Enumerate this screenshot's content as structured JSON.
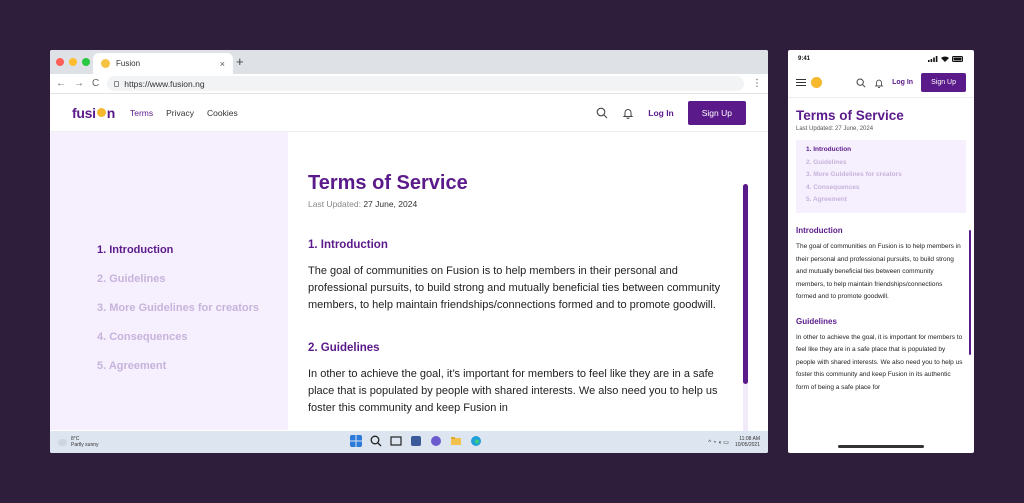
{
  "browser": {
    "tab_title": "Fusion",
    "tab_close": "×",
    "new_tab": "+",
    "back": "←",
    "forward": "→",
    "reload": "C",
    "url": "https://www.fusion.ng",
    "menu": "⋮"
  },
  "site": {
    "logo_pre": "fusi",
    "logo_post": "n",
    "nav": [
      "Terms",
      "Privacy",
      "Cookies"
    ],
    "login": "Log In",
    "signup": "Sign Up"
  },
  "toc": [
    "1. Introduction",
    "2. Guidelines",
    "3. More Guidelines for creators",
    "4. Consequences",
    "5. Agreement"
  ],
  "doc": {
    "title": "Terms of Service",
    "updated_label": "Last Updated:",
    "updated_date": "27 June, 2024",
    "sections": [
      {
        "heading": "1. Introduction",
        "body": "The goal of communities on Fusion is to help members in their personal and professional pursuits, to build strong and mutually beneficial ties between community members, to help maintain friendships/connections formed and to promote goodwill."
      },
      {
        "heading": "2. Guidelines",
        "body": "In other to achieve the goal, it’s important for members to feel like they are in a safe place that is populated by people with shared interests. We also need you to help us foster this community and keep Fusion in"
      }
    ]
  },
  "taskbar": {
    "temp": "8°C",
    "weather": "Partly sunny",
    "time": "11:08 AM",
    "date": "10/05/2021"
  },
  "mobile": {
    "time": "9:41",
    "login": "Log In",
    "signup": "Sign Up",
    "title": "Terms of Service",
    "updated": "Last Updated: 27 June, 2024",
    "toc": [
      "1. Introduction",
      "2. Guidelines",
      "3. More Guidelines for creators",
      "4. Consequences",
      "5. Agreement"
    ],
    "sections": [
      {
        "heading": "Introduction",
        "body": "The goal of communities on Fusion is to help members in their personal and professional pursuits, to build strong and mutually beneficial ties between community members, to help maintain friendships/connections formed and to promote goodwill."
      },
      {
        "heading": "Guidelines",
        "body": "In other to achieve the goal, it is important for members to feel like they are in a safe place that is populated by people with shared interests. We also need you to help us foster this community and keep Fusion in its authentic form of being a safe place for"
      }
    ]
  },
  "colors": {
    "brand": "#5b1a8a",
    "accent": "#f5b82e",
    "toc_inactive": "#c6b4dc",
    "sidebar_bg": "#f6effd"
  }
}
